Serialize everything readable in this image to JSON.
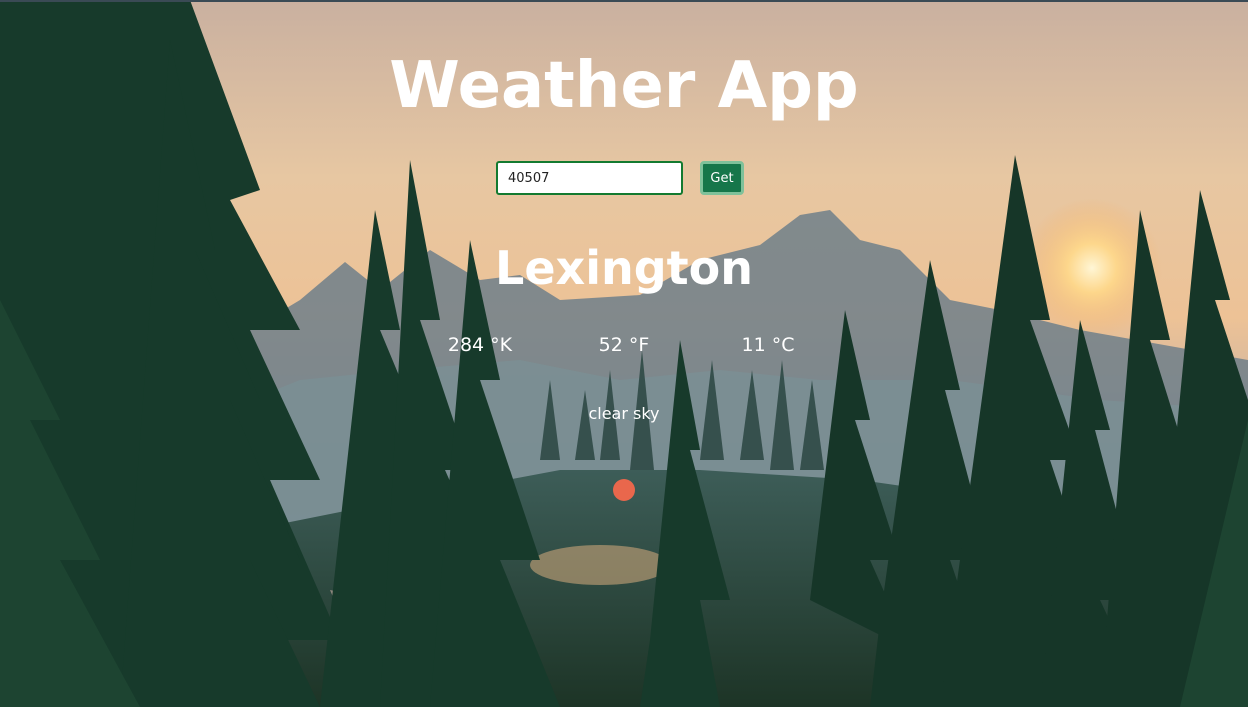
{
  "app": {
    "title": "Weather App"
  },
  "search": {
    "value": "40507",
    "button_label": "Get"
  },
  "weather": {
    "city": "Lexington",
    "kelvin": "284 °K",
    "fahrenheit": "52 °F",
    "celsius": "11 °C",
    "description": "clear sky",
    "icon": "weather-status-dot-icon"
  },
  "colors": {
    "button_bg": "#16764a",
    "input_border": "#137a30",
    "dot": "#e9674c",
    "text": "#ffffff"
  }
}
